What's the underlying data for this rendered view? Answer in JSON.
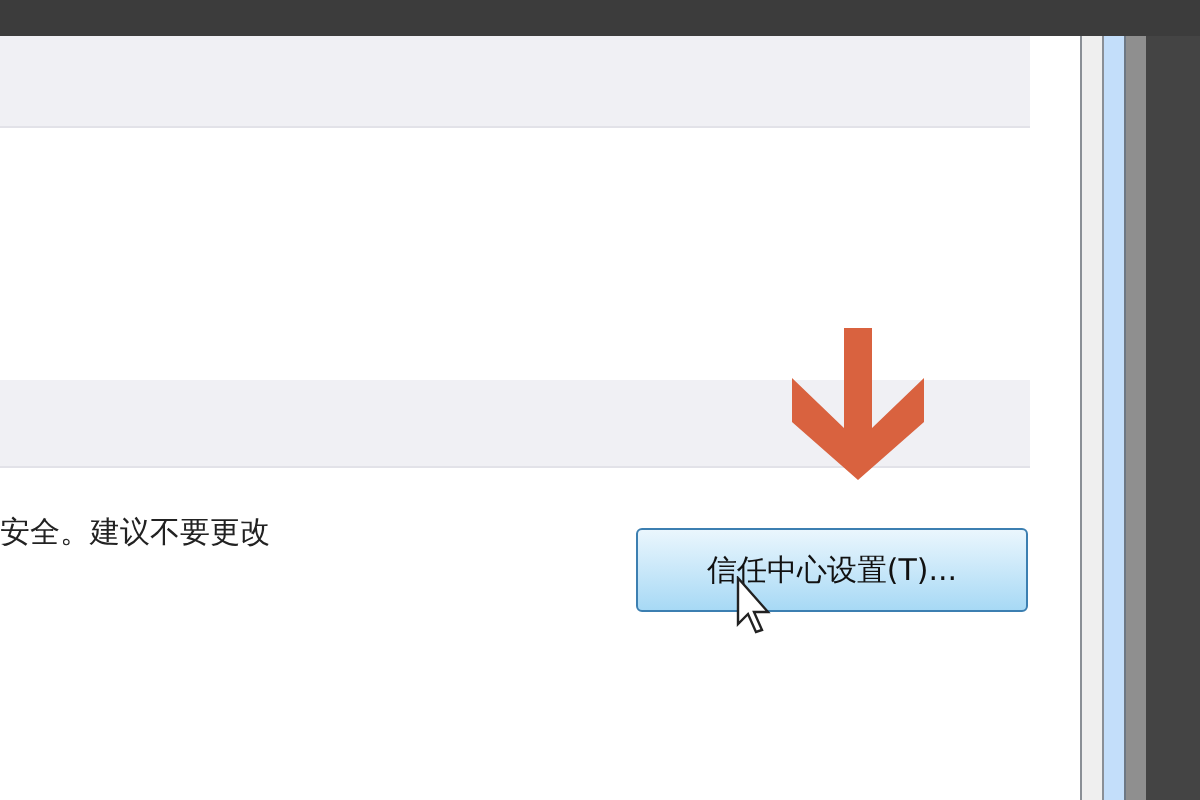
{
  "description": "安全。建议不要更改",
  "button": {
    "label": "信任中心设置(T)..."
  }
}
